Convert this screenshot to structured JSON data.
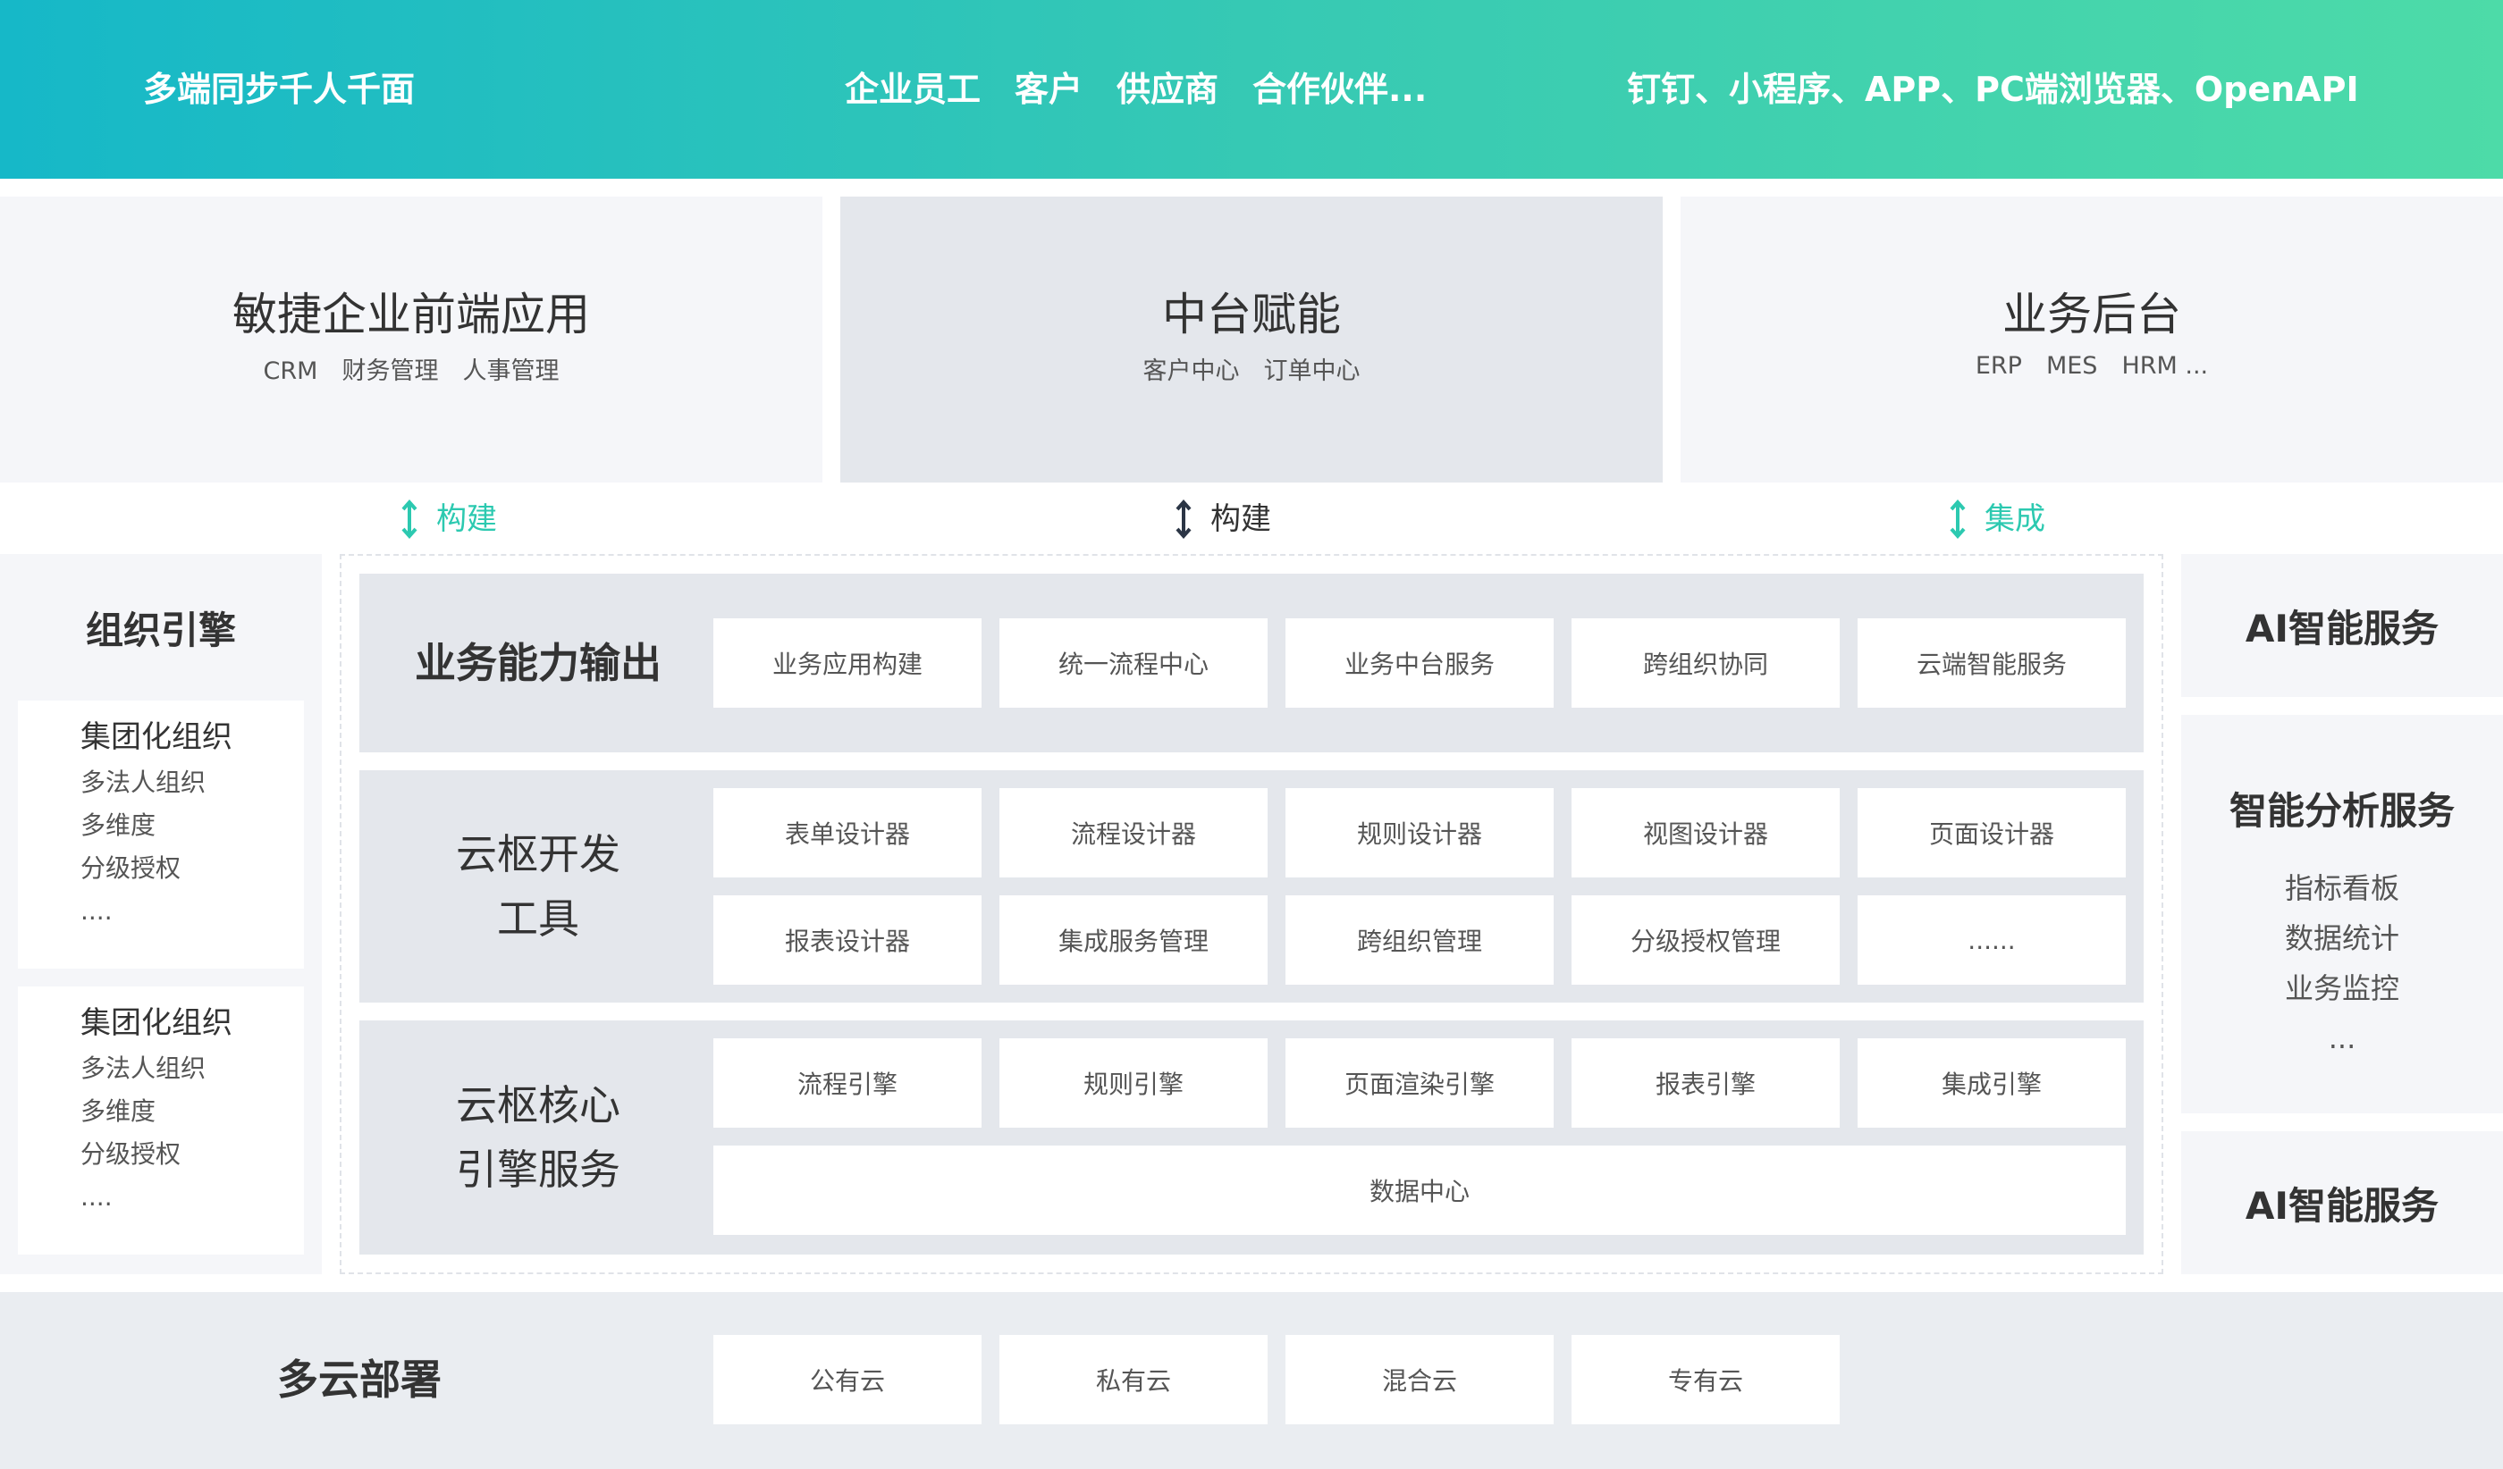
{
  "banner": {
    "left_text": "多端同步千人千面",
    "mid_text": "企业员工　客户　供应商　合作伙伴...",
    "right_text": "钉钉、小程序、APP、PC端浏览器、OpenAPI",
    "gradient": [
      "#16b8c8",
      "#4ddba8"
    ]
  },
  "top_panels": [
    {
      "title": "敏捷企业前端应用",
      "subtitle": "CRM　财务管理　人事管理"
    },
    {
      "title": "中台赋能",
      "subtitle": "客户中心　订单中心"
    },
    {
      "title": "业务后台",
      "subtitle": "ERP　MES　HRM ..."
    }
  ],
  "connectors": [
    {
      "label": "构建",
      "color": "#2cc9b0"
    },
    {
      "label": "构建",
      "color": "#333333"
    },
    {
      "label": "集成",
      "color": "#2cc9b0"
    }
  ],
  "left_column": {
    "title": "组织引擎",
    "cards": [
      {
        "heading": "集团化组织",
        "items": [
          "多法人组织",
          "多维度",
          "分级授权",
          "...."
        ]
      },
      {
        "heading": "集团化组织",
        "items": [
          "多法人组织",
          "多维度",
          "分级授权",
          "...."
        ]
      }
    ]
  },
  "center": {
    "rows": [
      {
        "label": [
          "业务能力输出"
        ],
        "cells": [
          "业务应用构建",
          "统一流程中心",
          "业务中台服务",
          "跨组织协同",
          "云端智能服务"
        ]
      },
      {
        "label": [
          "云枢开发",
          "工具"
        ],
        "cells": [
          "表单设计器",
          "流程设计器",
          "规则设计器",
          "视图设计器",
          "页面设计器",
          "报表设计器",
          "集成服务管理",
          "跨组织管理",
          "分级授权管理",
          "......"
        ]
      },
      {
        "label": [
          "云枢核心",
          "引擎服务"
        ],
        "cells": [
          "流程引擎",
          "规则引擎",
          "页面渲染引擎",
          "报表引擎",
          "集成引擎"
        ],
        "wide_cell": "数据中心"
      }
    ]
  },
  "right_column": {
    "top_title": "AI智能服务",
    "mid_title": "智能分析服务",
    "mid_items": [
      "指标看板",
      "数据统计",
      "业务监控",
      "..."
    ],
    "bottom_title": "AI智能服务"
  },
  "bottom": {
    "label": "多云部署",
    "cells": [
      "公有云",
      "私有云",
      "混合云",
      "专有云"
    ]
  }
}
